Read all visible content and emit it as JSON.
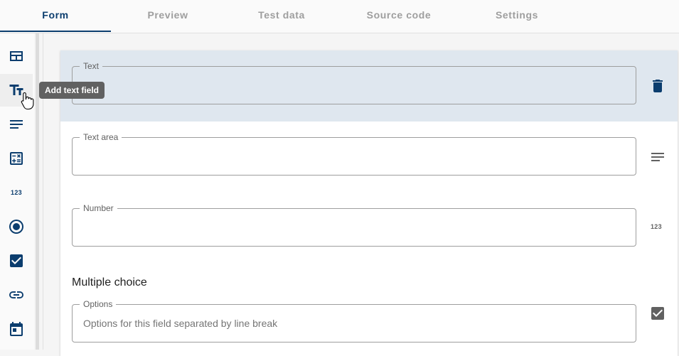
{
  "tabs": [
    {
      "label": "Form",
      "active": true
    },
    {
      "label": "Preview",
      "active": false
    },
    {
      "label": "Test data",
      "active": false
    },
    {
      "label": "Source code",
      "active": false
    },
    {
      "label": "Settings",
      "active": false
    }
  ],
  "toolbar": {
    "items": [
      {
        "icon": "layout-icon"
      },
      {
        "icon": "text-field-icon"
      },
      {
        "icon": "text-area-icon"
      },
      {
        "icon": "calculator-icon"
      },
      {
        "icon": "number-icon",
        "text": "123"
      },
      {
        "icon": "radio-icon"
      },
      {
        "icon": "checkbox-icon"
      },
      {
        "icon": "link-icon"
      },
      {
        "icon": "calendar-icon"
      }
    ],
    "tooltip": "Add text field"
  },
  "form": {
    "fields": [
      {
        "label": "Text",
        "value": "",
        "action_icon": "delete-icon"
      },
      {
        "label": "Text area",
        "value": "",
        "action_icon": "text-area-icon"
      },
      {
        "label": "Number",
        "value": "",
        "action_icon": "number-icon",
        "action_text": "123"
      }
    ],
    "multiple_choice": {
      "title": "Multiple choice",
      "options_label": "Options",
      "options_placeholder": "Options for this field separated by line break",
      "action_icon": "checkbox-icon"
    }
  },
  "colors": {
    "accent": "#0b3d6e",
    "selected_row": "#dfe7ef",
    "tooltip_bg": "#616161"
  }
}
